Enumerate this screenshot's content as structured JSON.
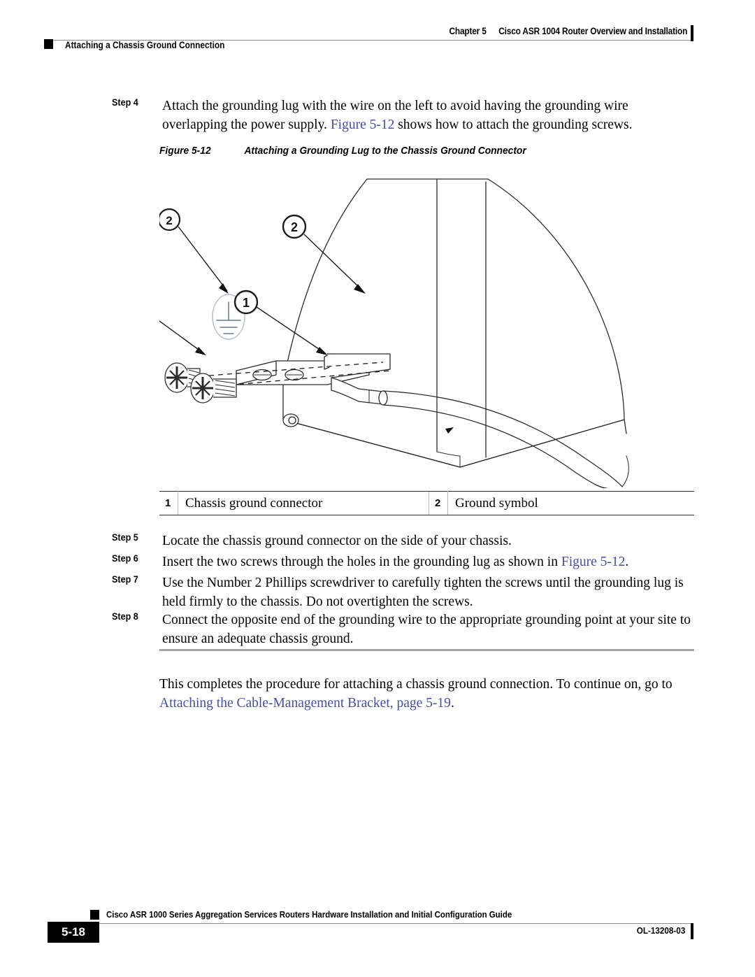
{
  "header": {
    "chapter_label": "Chapter 5",
    "chapter_title": "Cisco ASR 1004 Router Overview and Installation",
    "section_title": "Attaching a Chassis Ground Connection"
  },
  "steps_before_figure": [
    {
      "label": "Step 4",
      "text_part1": "Attach the grounding lug with the wire on the left to avoid having the grounding wire overlapping the power supply. ",
      "link": "Figure 5-12",
      "text_part2": " shows how to attach the grounding screws."
    }
  ],
  "figure": {
    "number": "Figure 5-12",
    "title": "Attaching a Grounding Lug to the Chassis Ground Connector",
    "art_id": "280180",
    "callout_1": "1",
    "callout_2": "2",
    "ground_symbol_name": "ground-symbol"
  },
  "callout_table": {
    "rows": [
      {
        "num_a": "1",
        "text_a": "Chassis ground connector",
        "num_b": "2",
        "text_b": "Ground symbol"
      }
    ]
  },
  "steps_after_figure": [
    {
      "label": "Step 5",
      "text_part1": "Locate the chassis ground connector on the side of your chassis.",
      "link": "",
      "text_part2": ""
    },
    {
      "label": "Step 6",
      "text_part1": "Insert the two screws through the holes in the grounding lug as shown in ",
      "link": "Figure 5-12",
      "text_part2": "."
    },
    {
      "label": "Step 7",
      "text_part1": "Use the Number 2 Phillips screwdriver to carefully tighten the screws until the grounding lug is held firmly to the chassis. Do not overtighten the screws.",
      "link": "",
      "text_part2": ""
    },
    {
      "label": "Step 8",
      "text_part1": "Connect the opposite end of the grounding wire to the appropriate grounding point at your site to ensure an adequate chassis ground.",
      "link": "",
      "text_part2": ""
    }
  ],
  "closing": {
    "text_part1": "This completes the procedure for attaching a chassis ground connection. To continue on, go to ",
    "link": "Attaching the Cable-Management Bracket, page 5-19",
    "text_part2": "."
  },
  "footer": {
    "page_number": "5-18",
    "guide_title": "Cisco ASR 1000 Series Aggregation Services Routers Hardware Installation and Initial Configuration Guide",
    "doc_id": "OL-13208-03"
  },
  "colors": {
    "link": "#4a4ab3",
    "rule": "#8d8d8d",
    "text": "#000000"
  }
}
